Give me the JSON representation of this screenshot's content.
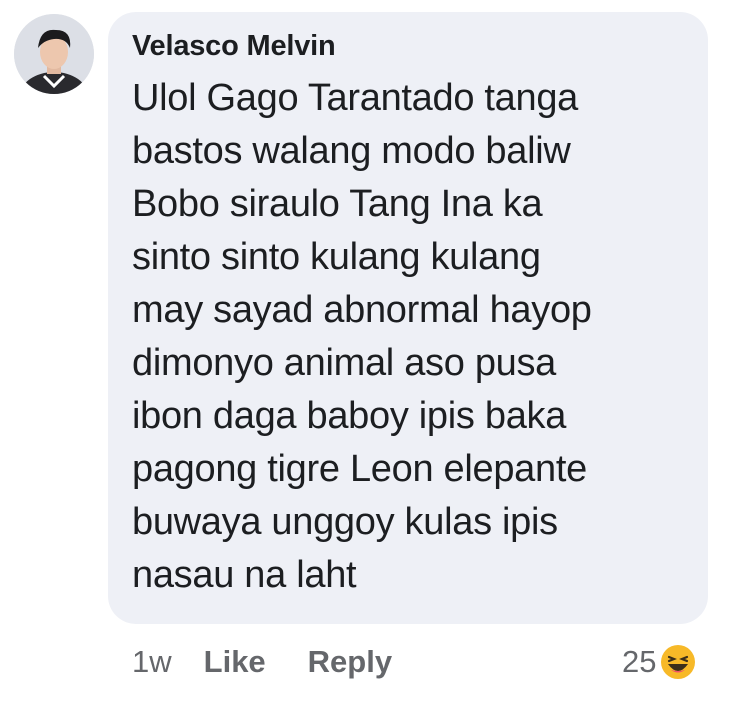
{
  "comment": {
    "author": "Velasco Melvin",
    "lines": [
      "Ulol Gago Tarantado tanga",
      "bastos walang modo baliw",
      "Bobo siraulo Tang Ina ka",
      "sinto sinto kulang kulang",
      "may sayad abnormal hayop",
      "dimonyo animal aso pusa",
      "ibon daga baboy ipis baka",
      "pagong tigre Leon elepante",
      "buwaya unggoy kulas ipis",
      "nasau na laht"
    ]
  },
  "actions": {
    "time": "1w",
    "like_label": "Like",
    "reply_label": "Reply"
  },
  "reactions": {
    "count": "25",
    "icon": "haha-reaction-icon"
  },
  "colors": {
    "bubble": "#eef0f6",
    "text": "#1c1e21",
    "meta": "#65676b",
    "haha": "#f7b928"
  }
}
